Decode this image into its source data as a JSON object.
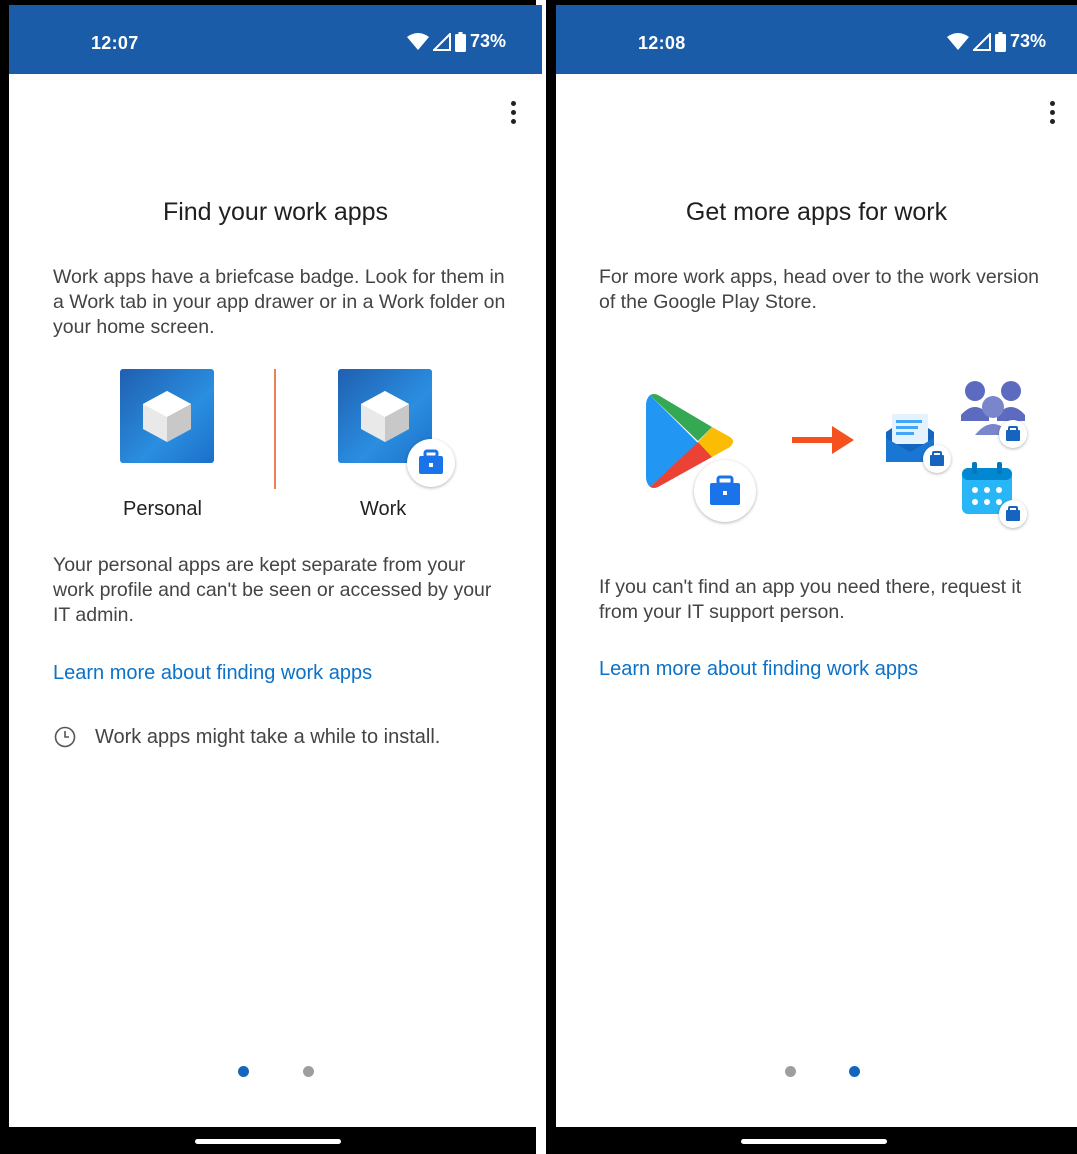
{
  "colors": {
    "status_bar": "#1a5ca7",
    "link": "#0b72c8",
    "dot_active": "#1565c0",
    "dot_inactive": "#9e9e9e",
    "arrow": "#f4511e"
  },
  "screens": [
    {
      "time": "12:07",
      "battery": "73%",
      "title": "Find your work apps",
      "intro": "Work apps have a briefcase badge. Look for them in a Work tab in your app drawer or in a Work folder on your home screen.",
      "personal_label": "Personal",
      "work_label": "Work",
      "body": "Your personal apps are kept separate from your work profile and can't be seen or accessed by your IT admin.",
      "link": "Learn more about finding work apps",
      "note": "Work apps might take a while to install.",
      "page_indicator": {
        "current": 1,
        "total": 2
      }
    },
    {
      "time": "12:08",
      "battery": "73%",
      "title": "Get more apps for work",
      "intro": "For more work apps, head over to the work version of the Google Play Store.",
      "body": "If you can't find an app you need there, request it from your IT support person.",
      "link": "Learn more about finding work apps",
      "page_indicator": {
        "current": 2,
        "total": 2
      }
    }
  ]
}
